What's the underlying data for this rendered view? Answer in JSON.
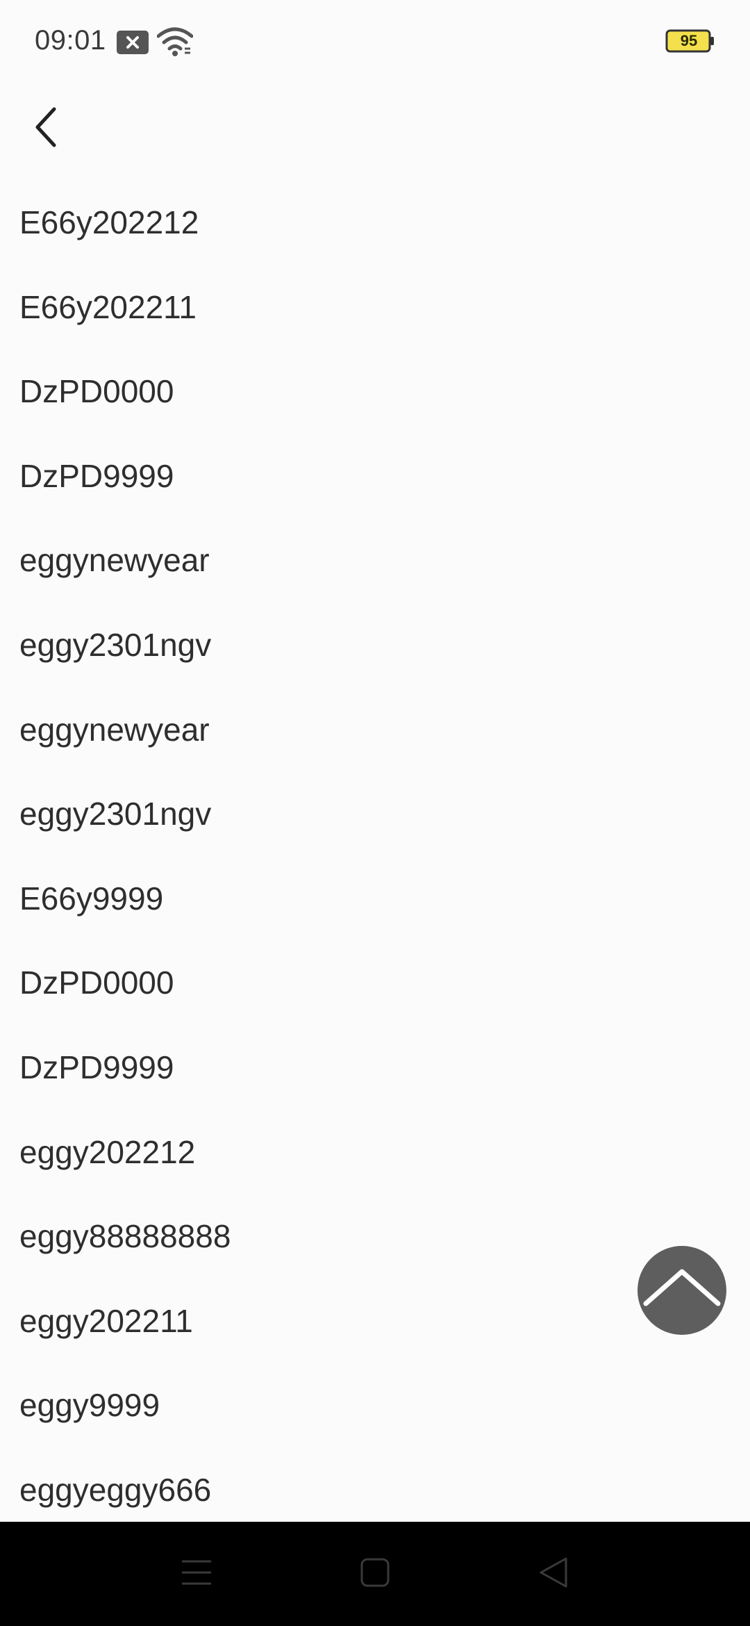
{
  "status_bar": {
    "time": "09:01",
    "battery_level": "95",
    "icons": [
      "notification-blocked-icon",
      "wifi-icon",
      "battery-icon"
    ],
    "battery_color": "#f4e04d"
  },
  "header": {
    "back_icon": "chevron-left-icon"
  },
  "list": {
    "items": [
      "E66y202212",
      "E66y202211",
      "DzPD0000",
      "DzPD9999",
      "eggynewyear",
      "eggy2301ngv",
      "eggynewyear",
      "eggy2301ngv",
      "E66y9999",
      "DzPD0000",
      "DzPD9999",
      "eggy202212",
      "eggy88888888",
      "eggy202211",
      "eggy9999",
      "eggyeggy666"
    ]
  },
  "scroll_top_button": {
    "icon": "chevron-up-icon",
    "color": "#5e5e5e"
  },
  "nav_bar": {
    "icons": [
      "menu-icon",
      "home-icon",
      "back-triangle-icon"
    ]
  }
}
